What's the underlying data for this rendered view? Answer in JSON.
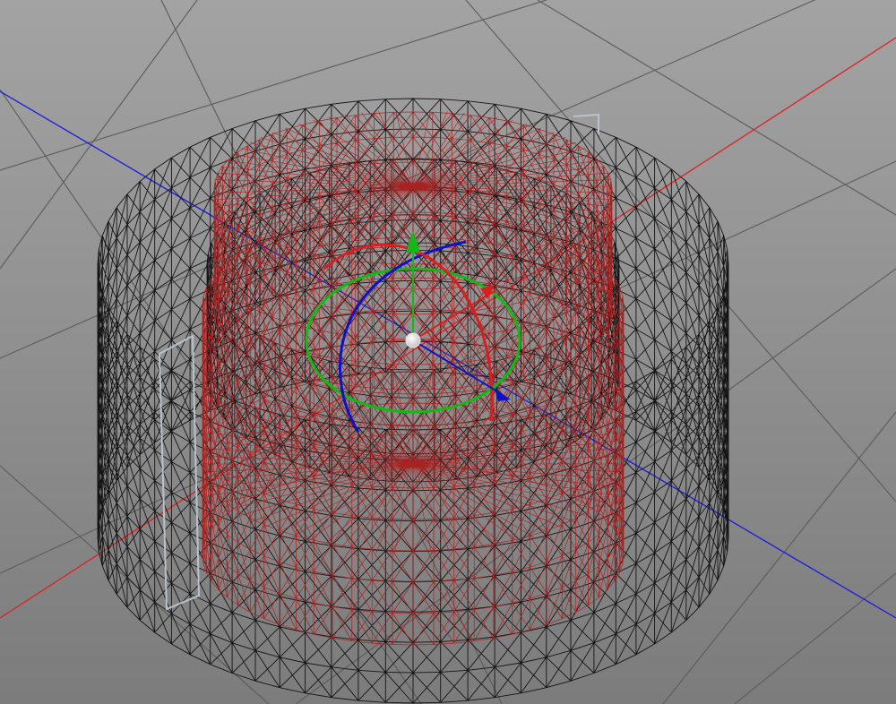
{
  "viewport": {
    "background_top": "#a3a3a3",
    "background_bottom": "#7c7c7c",
    "grid_color": "#5a5a5a"
  },
  "axes": {
    "x_color": "#e02020",
    "z_color": "#1a1ae0",
    "y_color": "#20b020"
  },
  "outer_mesh": {
    "color": "#141414",
    "highlight": "#b8c2cf"
  },
  "inner_mesh": {
    "color": "#a82222"
  },
  "gizmo": {
    "x_color": "#d81e1e",
    "y_color": "#14b814",
    "z_color": "#1010c8",
    "y_arrow_icon": "arrow-up-icon",
    "pivot_icon": "pivot-sphere-icon",
    "pivot_color": "#ffffff"
  }
}
